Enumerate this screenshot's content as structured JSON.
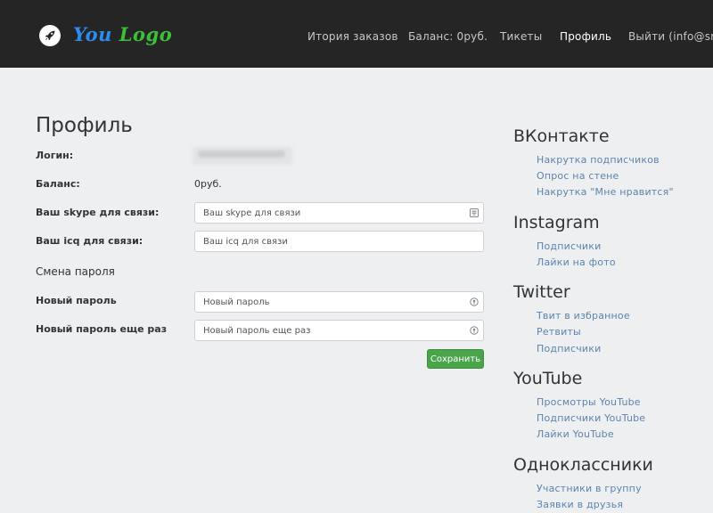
{
  "header": {
    "logo_word1": "You",
    "logo_word2": "Logo",
    "nav": [
      {
        "label": "Итория заказов"
      },
      {
        "label": "Баланс: 0руб."
      },
      {
        "label": "Тикеты"
      },
      {
        "label": "Профиль"
      },
      {
        "label": "Выйти (info@sm..."
      }
    ]
  },
  "profile": {
    "title": "Профиль",
    "login_label": "Логин:",
    "balance_label": "Баланс:",
    "balance_value": "0руб.",
    "skype_label": "Ваш skype для связи:",
    "skype_placeholder": "Ваш skype для связи",
    "icq_label": "Ваш icq для связи:",
    "icq_placeholder": "Ваш icq для связи",
    "password_section": "Смена пароля",
    "new_password_label": "Новый пароль",
    "new_password_placeholder": "Новый пароль",
    "repeat_password_label": "Новый пароль еще раз",
    "repeat_password_placeholder": "Новый пароль еще раз",
    "save_label": "Сохранить"
  },
  "sidebar": [
    {
      "heading": "ВКонтакте",
      "links": [
        "Накрутка подписчиков",
        "Опрос на стене",
        "Накрутка \"Мне нравится\""
      ]
    },
    {
      "heading": "Instagram",
      "links": [
        "Подписчики",
        "Лайки на фото"
      ]
    },
    {
      "heading": "Twitter",
      "links": [
        "Твит в избранное",
        "Ретвиты",
        "Подписчики"
      ]
    },
    {
      "heading": "YouTube",
      "links": [
        "Просмотры YouTube",
        "Подписчики YouTube",
        "Лайки YouTube"
      ]
    },
    {
      "heading": "Одноклассники",
      "links": [
        "Участники в группу",
        "Заявки в друзья"
      ]
    }
  ],
  "colors": {
    "header_bg": "#252525",
    "page_bg": "#eeeff1",
    "link": "#5c84ad",
    "save_button": "#4aa54a",
    "logo_blue": "#2c8df0",
    "logo_green": "#3cbf39"
  }
}
